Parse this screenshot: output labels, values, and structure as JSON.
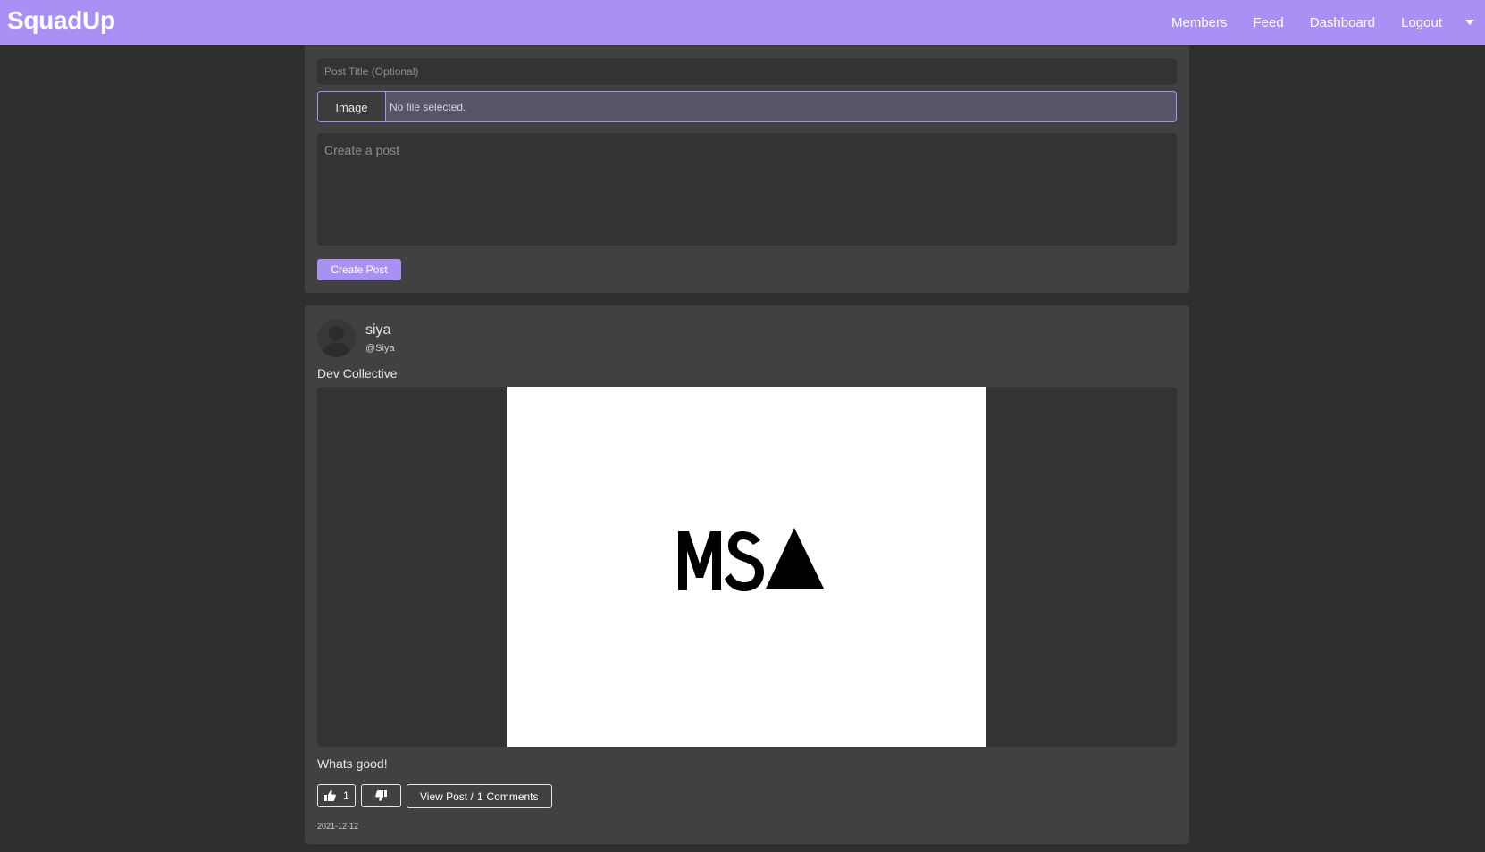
{
  "navbar": {
    "brand": "SquadUp",
    "links": [
      {
        "label": "Members"
      },
      {
        "label": "Feed"
      },
      {
        "label": "Dashboard"
      },
      {
        "label": "Logout"
      }
    ],
    "accent_color": "#a990f4"
  },
  "create_post": {
    "title_placeholder": "Post Title (Optional)",
    "image_button_label": "Image",
    "file_status": "No file selected.",
    "body_placeholder": "Create a post",
    "submit_label": "Create Post"
  },
  "post": {
    "author_name": "siya",
    "author_handle": "@Siya",
    "title": "Dev Collective",
    "image_logo_text": "MSA",
    "body": "Whats good!",
    "like_count": "1",
    "view_label": "View Post /",
    "comment_count": "1",
    "comments_label": "Comments",
    "date": "2021-12-12"
  },
  "icons": [
    "avatar-placeholder-icon",
    "thumbs-up-icon",
    "thumbs-down-icon",
    "caret-down-icon"
  ]
}
